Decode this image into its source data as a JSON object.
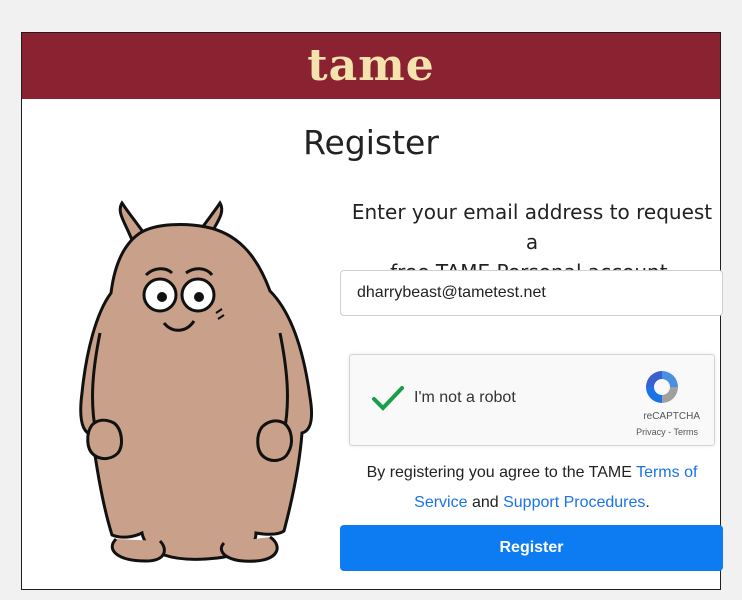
{
  "header": {
    "logo_text": "tame",
    "bg_color": "#8b2232",
    "logo_color": "#f5e3ad"
  },
  "page": {
    "title": "Register"
  },
  "mascot": {
    "icon": "monster-mascot"
  },
  "intro": {
    "line1": "Enter your email address to request a",
    "line2": "free TAME Personal account."
  },
  "email_field": {
    "value": "dharrybeast@tametest.net"
  },
  "captcha": {
    "label": "I'm not a robot",
    "checked": true,
    "brand": "reCAPTCHA",
    "privacy": "Privacy",
    "separator": " - ",
    "terms": "Terms"
  },
  "agreement": {
    "prefix": "By registering you agree to the TAME ",
    "terms_link": "Terms of Service",
    "middle": " and ",
    "support_link": "Support Procedures",
    "suffix": "."
  },
  "register_button": {
    "label": "Register",
    "color": "#0d7cf2"
  }
}
